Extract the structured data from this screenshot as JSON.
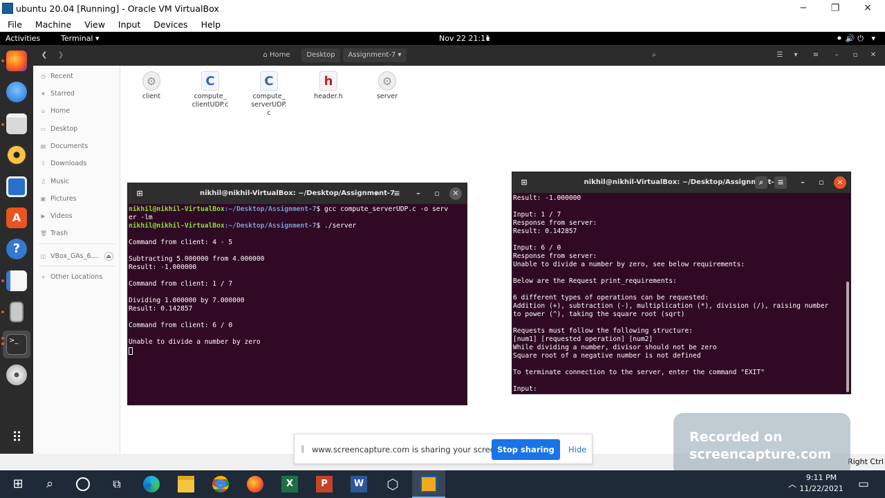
{
  "window": {
    "title": "ubuntu 20.04 [Running] - Oracle VM VirtualBox",
    "minimize": "─",
    "restore": "❐",
    "close": "✕"
  },
  "vb_menu": [
    "File",
    "Machine",
    "View",
    "Input",
    "Devices",
    "Help"
  ],
  "gnome_top": {
    "activities": "Activities",
    "app": "Terminal ▾",
    "clock": "Nov 22  21:11",
    "tray": "⚫🔊⏻ ▾"
  },
  "dock_apps": [
    "firefox-icon",
    "thunderbird-icon",
    "files-icon",
    "rhythmbox-icon",
    "libreoffice-writer-icon",
    "software-center-icon",
    "help-icon",
    "text-editor-icon",
    "usb-drive-icon",
    "terminal-icon",
    "dvd-icon",
    "app-grid-icon"
  ],
  "files": {
    "breadcrumb": [
      "Home",
      "Desktop",
      "Assignment-7 ▾"
    ],
    "sidebar": [
      {
        "icon": "◷",
        "label": "Recent"
      },
      {
        "icon": "★",
        "label": "Starred"
      },
      {
        "icon": "⌂",
        "label": "Home"
      },
      {
        "icon": "▭",
        "label": "Desktop"
      },
      {
        "icon": "▤",
        "label": "Documents"
      },
      {
        "icon": "⇩",
        "label": "Downloads"
      },
      {
        "icon": "♫",
        "label": "Music"
      },
      {
        "icon": "▣",
        "label": "Pictures"
      },
      {
        "icon": "▶",
        "label": "Videos"
      },
      {
        "icon": "🗑",
        "label": "Trash"
      },
      {
        "icon": "◫",
        "label": "VBox_GAs_6...."
      },
      {
        "icon": "+",
        "label": "Other Locations"
      }
    ],
    "items": [
      {
        "name": "client",
        "glyph": "⚙"
      },
      {
        "name": "compute_\nclientUDP.c",
        "glyph": "C"
      },
      {
        "name": "compute_\nserverUDP.\nc",
        "glyph": "C"
      },
      {
        "name": "header.h",
        "glyph": "h"
      },
      {
        "name": "server",
        "glyph": "⚙"
      }
    ]
  },
  "term_left": {
    "title": "nikhil@nikhil-VirtualBox: ~/Desktop/Assignment-7",
    "prompt_user": "nikhil@nikhil-VirtualBox",
    "prompt_path": ":~/Desktop/Assignment-7",
    "cmd1": "$ gcc compute_serverUDP.c -o serv",
    "cmd1_wrap": "er -lm",
    "cmd2": "$ ./server",
    "output": "\nCommand from client: 4 - 5\n\nSubtracting 5.000000 from 4.000000\nResult: -1.000000\n\nCommand from client: 1 / 7\n\nDividing 1.000000 by 7.000000\nResult: 0.142857\n\nCommand from client: 6 / 0\n\nUnable to divide a number by zero\n"
  },
  "term_right": {
    "title": "nikhil@nikhil-VirtualBox: ~/Desktop/Assignment-7",
    "output": "Result: -1.000000\n\nInput: 1 / 7\nResponse from server:\nResult: 0.142857\n\nInput: 6 / 0\nResponse from server:\nUnable to divide a number by zero, see below requirements:\n\nBelow are the Request print_requirements:\n\n6 different types of operations can be requested:\nAddition (+), subtraction (-), multiplication (*), division (/), raising number\nto power (^), taking the square root (sqrt)\n\nRequests must follow the following structure:\n[num1] [requested operation] [num2]\nWhile dividing a number, divisor should not be zero\nSquare root of a negative number is not defined\n\nTo terminate connection to the server, enter the command \"EXIT\"\n\nInput:"
  },
  "share_bar": {
    "message": "www.screencapture.com is sharing your screen.",
    "stop": "Stop sharing",
    "hide": "Hide"
  },
  "watermark": {
    "line1": "Recorded on",
    "line2": "screencapture.com"
  },
  "vb_status": {
    "host_key": "Right Ctrl"
  },
  "taskbar": {
    "time": "9:11 PM",
    "date": "11/22/2021"
  },
  "colors": {
    "terminal_bg": "#300a24",
    "prompt_user": "#8ae234",
    "prompt_path": "#729fcf",
    "accent": "#1a73e8"
  }
}
